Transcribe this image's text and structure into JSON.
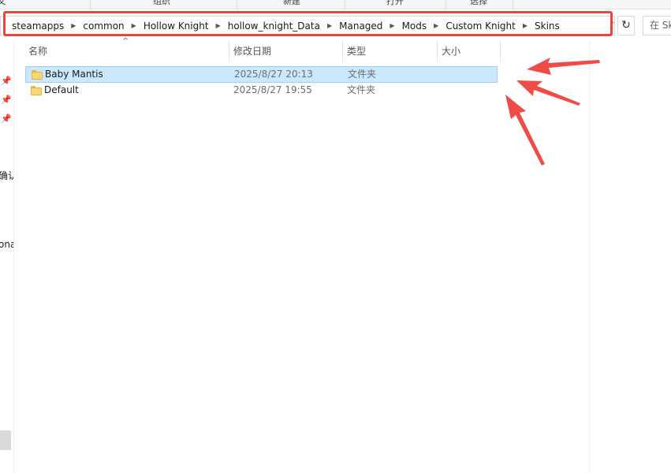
{
  "ribbon": {
    "groups": [
      "组织",
      "新建",
      "打开",
      "选择"
    ],
    "left_fragment": "夂"
  },
  "address_bar": {
    "breadcrumbs": [
      "steamapps",
      "common",
      "Hollow Knight",
      "hollow_knight_Data",
      "Managed",
      "Mods",
      "Custom Knight",
      "Skins"
    ],
    "refresh_icon": "↻",
    "dropdown_icon": "⌄"
  },
  "search": {
    "placeholder": "在 Skins"
  },
  "nav_pane": {
    "fragment_1": "确认",
    "fragment_2": "ona"
  },
  "columns": {
    "name": "名称",
    "date": "修改日期",
    "type": "类型",
    "size": "大小"
  },
  "files": [
    {
      "name": "Baby Mantis",
      "date": "2025/8/27 20:13",
      "type": "文件夹",
      "selected": true
    },
    {
      "name": "Default",
      "date": "2025/8/27 19:55",
      "type": "文件夹",
      "selected": false
    }
  ],
  "annotations": {
    "highlight_color": "#e8453c",
    "arrow_color": "#ef4b47"
  }
}
